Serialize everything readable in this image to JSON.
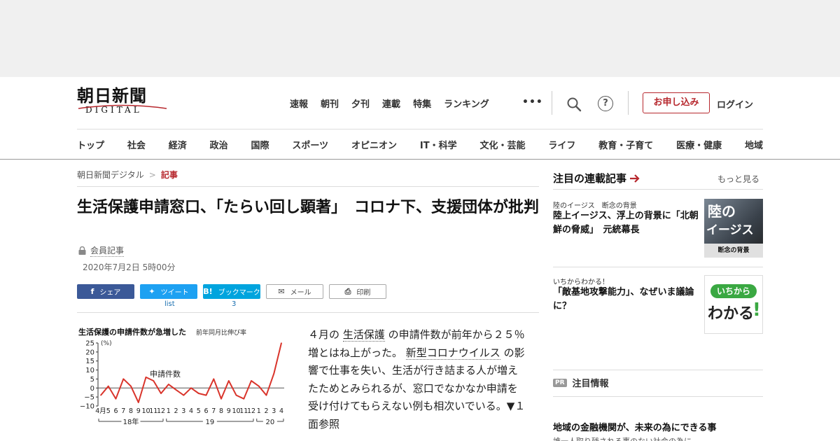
{
  "site": {
    "logo_jp": "朝日新聞",
    "logo_en": "DIGITAL"
  },
  "top_nav": [
    "速報",
    "朝刊",
    "夕刊",
    "連載",
    "特集",
    "ランキング"
  ],
  "more_label": "•••",
  "help_label": "?",
  "apply_button": "お申し込み",
  "login_link": "ログイン",
  "categories": [
    "トップ",
    "社会",
    "経済",
    "政治",
    "国際",
    "スポーツ",
    "オピニオン",
    "IT・科学",
    "文化・芸能",
    "ライフ",
    "教育・子育て",
    "医療・健康",
    "地域"
  ],
  "breadcrumb": {
    "home": "朝日新聞デジタル",
    "sep": ">",
    "current": "記事"
  },
  "article": {
    "title": "生活保護申請窓口、「たらい回し顕著」　コロナ下、支援団体が批判",
    "member_label": "会員記事",
    "date": "2020年7月2日 5時00分",
    "body_1": "４月の ",
    "link_1": "生活保護",
    "body_2": " の申請件数が前年から２５％増とはね上がった。 ",
    "link_2": "新型コロナウイルス",
    "body_3": " の影響で仕事を失い、生活が行き詰まる人が増えたためとみられるが、窓口でなかなか申請を受け付けてもらえない例も相次いでいる。▼１面参照"
  },
  "share": {
    "facebook": "シェア",
    "twitter": "ツイート",
    "hatena": "ブックマーク",
    "mail": "メール",
    "print": "印刷",
    "twitter_count": "list",
    "hatena_count": "3"
  },
  "chart_data": {
    "type": "line",
    "title": "生活保護の申請件数が急増した",
    "subtitle": "前年同月比伸び率",
    "unit": "(%)",
    "series_label": "申請件数",
    "x": [
      "4月",
      "5",
      "6",
      "7",
      "8",
      "9",
      "10",
      "11",
      "12",
      "1",
      "2",
      "3",
      "4",
      "5",
      "6",
      "7",
      "8",
      "9",
      "10",
      "11",
      "12",
      "1",
      "2",
      "3",
      "4"
    ],
    "year_groups": [
      "18年",
      "19",
      "20"
    ],
    "values": [
      -4,
      1,
      -6,
      5,
      1,
      -8,
      6,
      4,
      -3,
      2,
      -1,
      -4,
      0,
      -3,
      -4,
      5,
      -6,
      4,
      -4,
      -6,
      4,
      1,
      -4,
      8,
      25
    ],
    "yticks": [
      "25",
      "20",
      "15",
      "10",
      "5",
      "0",
      "−5",
      "−10"
    ],
    "ylim": [
      -10,
      25
    ],
    "line_color": "#d9342b",
    "zero_line_color": "#555555"
  },
  "sidebar": {
    "heading": "注目の連載記事",
    "more": "もっと見る",
    "cards": [
      {
        "tag": "陸のイージス　断念の背景",
        "title": "陸上イージス、浮上の背景に「北朝鮮の脅威」　元統幕長",
        "thumb_big": "陸の",
        "thumb_mid": "イージス",
        "thumb_small": "断念の背景"
      },
      {
        "tag": "いちからわかる！",
        "title": "「敵基地攻撃能力」、なぜいま議論に？",
        "thumb_top": "いちから",
        "thumb_big": "わかる",
        "thumb_excl": "!"
      }
    ],
    "pr_badge": "PR",
    "pr_heading": "注目情報",
    "pr_title": "地域の金融機関が、未来の為にできる事",
    "pr_sub": "誰一人取り残される事のない社会の為に"
  },
  "colors": {
    "brand_red": "#b7282e",
    "facebook": "#3b5998",
    "twitter": "#1da1f2",
    "hatena": "#00a4de"
  }
}
